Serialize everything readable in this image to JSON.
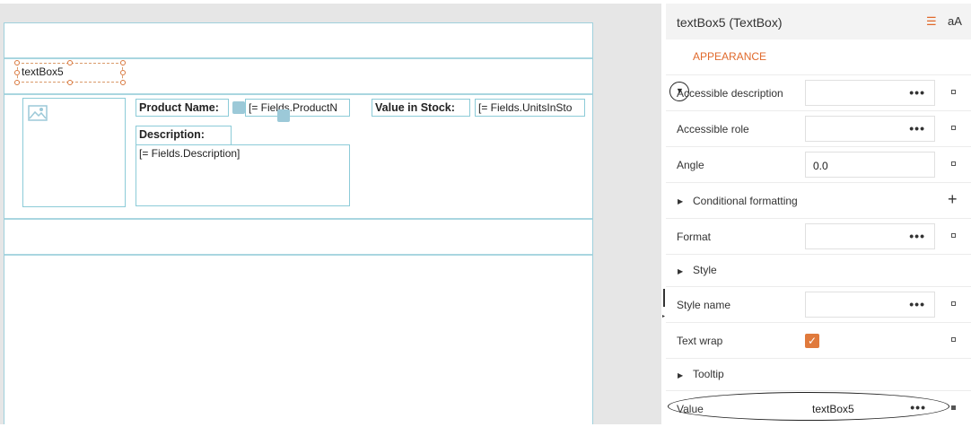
{
  "designer": {
    "selected_textbox": "textBox5",
    "product_name_label": "Product Name:",
    "product_name_field": "[= Fields.ProductN",
    "value_in_stock_label": "Value in Stock:",
    "units_in_stock_field": "[= Fields.UnitsInSto",
    "description_label": "Description:",
    "description_field": "[= Fields.Description]"
  },
  "panel": {
    "title": "textBox5 (TextBox)",
    "toolbar_icon_sort": "☰",
    "toolbar_icon_font": "aA",
    "section": "APPEARANCE",
    "rows": [
      {
        "label": "Accessible description",
        "value": "",
        "ellipsis": "•••"
      },
      {
        "label": "Accessible role",
        "value": "",
        "ellipsis": "•••"
      },
      {
        "label": "Angle",
        "value": "0.0"
      },
      {
        "label": "Conditional formatting",
        "action": "+"
      },
      {
        "label": "Format",
        "value": "",
        "ellipsis": "•••"
      },
      {
        "label": "Style"
      },
      {
        "label": "Style name",
        "value": "",
        "ellipsis": "•••"
      },
      {
        "label": "Text wrap",
        "checked": true,
        "check": "✓"
      },
      {
        "label": "Tooltip"
      },
      {
        "label": "Value",
        "value": "textBox5",
        "ellipsis": "•••"
      }
    ]
  },
  "colors": {
    "accent": "#e06a2c",
    "band_border": "#a9d6e0",
    "checkbox": "#e07a3c"
  }
}
